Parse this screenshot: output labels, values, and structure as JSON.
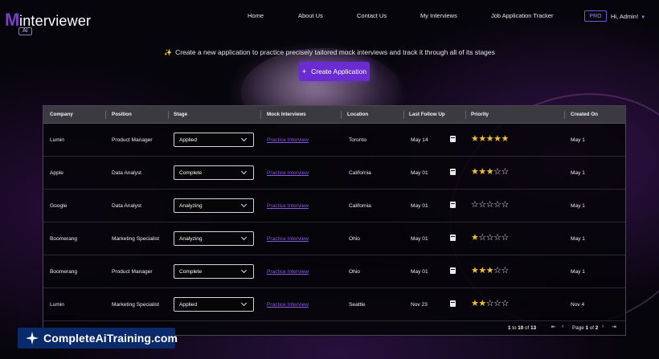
{
  "brand": {
    "m": "M",
    "name": "interviewer",
    "badge": "AI"
  },
  "nav": {
    "links": [
      "Home",
      "About Us",
      "Contact Us",
      "My Interviews",
      "Job Application Tracker"
    ],
    "pro": "PRO",
    "user": "Hi, Admin!"
  },
  "hero": {
    "tagline": "Create a new application to practice precisely tailored mock interviews and track it through all of its stages",
    "create_button": "Create Application"
  },
  "table": {
    "columns": [
      "Company",
      "Position",
      "Stage",
      "Mock Interviews",
      "Location",
      "Last Follow Up",
      "Priority",
      "Created On"
    ],
    "rows": [
      {
        "company": "Lumin",
        "position": "Product Manager",
        "stage": "Applied",
        "mock": "Practice Interview",
        "location": "Toronto",
        "follow_up": "May 14",
        "priority": 5,
        "created": "May 1"
      },
      {
        "company": "Apple",
        "position": "Data Analyst",
        "stage": "Complete",
        "mock": "Practice Interview",
        "location": "California",
        "follow_up": "May 01",
        "priority": 3,
        "created": "May 1"
      },
      {
        "company": "Google",
        "position": "Data Analyst",
        "stage": "Analyzing",
        "mock": "Practice Interview",
        "location": "California",
        "follow_up": "May 01",
        "priority": 0,
        "created": "May 1"
      },
      {
        "company": "Boomerang",
        "position": "Marketing Specialist",
        "stage": "Analyzing",
        "mock": "Practice Interview",
        "location": "Ohio",
        "follow_up": "May 01",
        "priority": 1,
        "created": "May 1"
      },
      {
        "company": "Boomerang",
        "position": "Product Manager",
        "stage": "Complete",
        "mock": "Practice Interview",
        "location": "Ohio",
        "follow_up": "May 01",
        "priority": 3,
        "created": "May 1"
      },
      {
        "company": "Lumin",
        "position": "Marketing Specialist",
        "stage": "Applied",
        "mock": "Practice Interview",
        "location": "Seattle",
        "follow_up": "Nov 23",
        "priority": 2,
        "created": "Nov 4"
      }
    ],
    "max_priority": 5
  },
  "pager": {
    "from": "1",
    "to": "10",
    "total": "13",
    "to_word": "to",
    "of_word": "of",
    "page_word": "Page",
    "page": "1",
    "pages": "2"
  },
  "watermark": {
    "text": "CompleteAiTraining.com"
  },
  "colors": {
    "accent": "#6a2bd0",
    "star": "#f2c230",
    "link": "#8a5ae0",
    "brand_m": "#7b3fc9"
  },
  "icons": {
    "tagline": "magic-wand-icon",
    "create": "plus-icon",
    "follow_up": "calendar-icon",
    "priority": "star-icon"
  }
}
